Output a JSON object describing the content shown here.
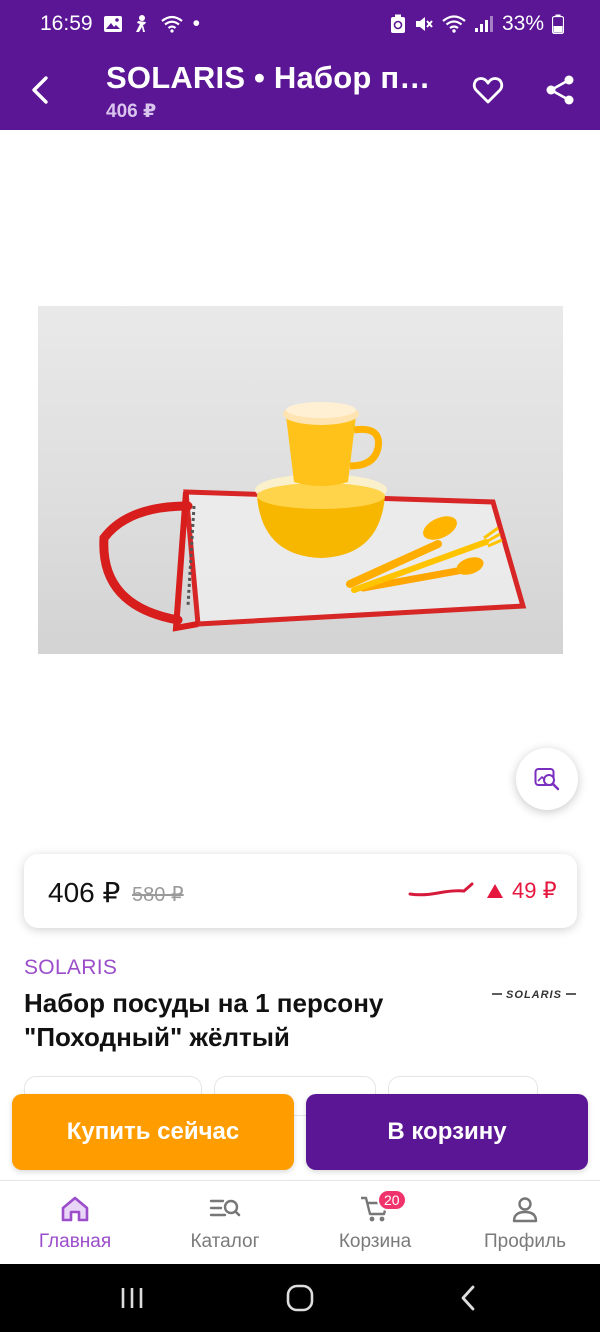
{
  "status_bar": {
    "time": "16:59",
    "dot": "•",
    "battery": "33%",
    "icons_left": [
      "gallery-icon",
      "accessibility-icon",
      "wifi-calling-icon"
    ],
    "icons_right": [
      "recycle-icon",
      "mute-icon",
      "wifi-icon",
      "signal-icon",
      "battery-icon"
    ]
  },
  "header": {
    "title": "SOLARIS • Набор пос...",
    "subtitle": "406 ₽",
    "back_icon": "back-arrow-icon",
    "favorite_icon": "heart-icon",
    "share_icon": "share-icon"
  },
  "product": {
    "image_icon": "product-photo",
    "find_similar_icon": "image-search-icon",
    "price": "406 ₽",
    "old_price": "580 ₽",
    "price_change": "49 ₽",
    "price_change_icon": "triangle-up-icon",
    "brand": "SOLARIS",
    "title": "Набор посуды на 1 персону \"Походный\" жёлтый",
    "brand_logo": "SOLARIS"
  },
  "actions": {
    "buy_now": "Купить сейчас",
    "add_to_cart": "В корзину"
  },
  "bottom_nav": {
    "items": [
      {
        "label": "Главная",
        "icon": "home-icon",
        "active": true
      },
      {
        "label": "Каталог",
        "icon": "catalog-search-icon",
        "active": false
      },
      {
        "label": "Корзина",
        "icon": "cart-icon",
        "active": false,
        "badge": "20"
      },
      {
        "label": "Профиль",
        "icon": "profile-icon",
        "active": false
      }
    ]
  },
  "colors": {
    "primary": "#5a1694",
    "accent": "#9b4dca",
    "buy": "#ff9d00",
    "price_up": "#e5173f",
    "badge": "#f0336b"
  }
}
